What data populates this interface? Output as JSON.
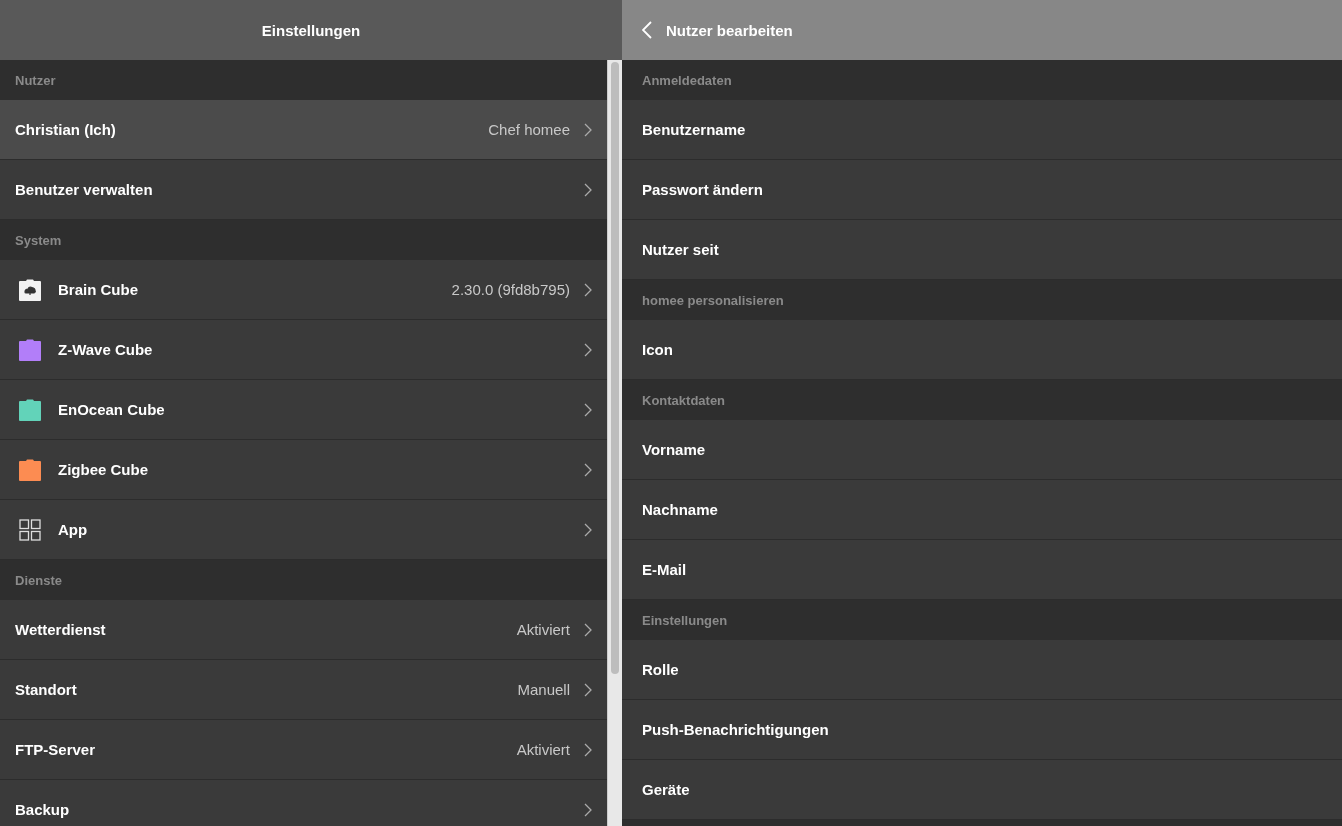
{
  "left_panel": {
    "title": "Einstellungen",
    "sections": [
      {
        "header": "Nutzer",
        "items": [
          {
            "label": "Christian (Ich)",
            "value": "Chef homee",
            "selected": true
          },
          {
            "label": "Benutzer verwalten",
            "selected": false
          }
        ]
      },
      {
        "header": "System",
        "items": [
          {
            "label": "Brain Cube",
            "value": "2.30.0 (9fd8b795)",
            "icon": {
              "kind": "brain"
            },
            "selected": false
          },
          {
            "label": "Z-Wave Cube",
            "icon": {
              "kind": "cube",
              "color": "#b27ef9"
            },
            "selected": false
          },
          {
            "label": "EnOcean Cube",
            "icon": {
              "kind": "cube",
              "color": "#62d3b9"
            },
            "selected": false
          },
          {
            "label": "Zigbee Cube",
            "icon": {
              "kind": "cube",
              "color": "#fc8c52"
            },
            "selected": false
          },
          {
            "label": "App",
            "icon": {
              "kind": "grid"
            },
            "selected": false
          }
        ]
      },
      {
        "header": "Dienste",
        "items": [
          {
            "label": "Wetterdienst",
            "value": "Aktiviert",
            "selected": false
          },
          {
            "label": "Standort",
            "value": "Manuell",
            "selected": false
          },
          {
            "label": "FTP-Server",
            "value": "Aktiviert",
            "selected": false
          },
          {
            "label": "Backup",
            "selected": false
          }
        ]
      }
    ]
  },
  "right_panel": {
    "title": "Nutzer bearbeiten",
    "sections": [
      {
        "header": "Anmeldedaten",
        "items": [
          "Benutzername",
          "Passwort ändern",
          "Nutzer seit"
        ]
      },
      {
        "header": "homee personalisieren",
        "items": [
          "Icon"
        ]
      },
      {
        "header": "Kontaktdaten",
        "items": [
          "Vorname",
          "Nachname",
          "E-Mail"
        ]
      },
      {
        "header": "Einstellungen",
        "items": [
          "Rolle",
          "Push-Benachrichtigungen",
          "Geräte"
        ]
      }
    ]
  }
}
